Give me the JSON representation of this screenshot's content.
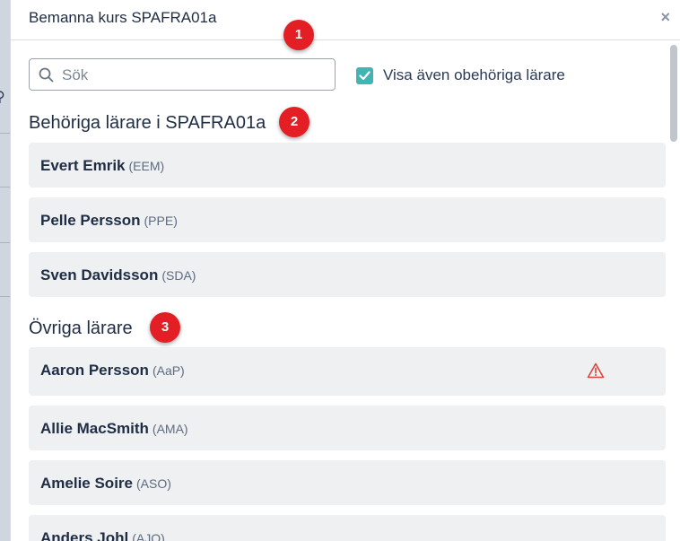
{
  "modal": {
    "title": "Bemanna kurs SPAFRA01a",
    "close_label": "×"
  },
  "search": {
    "placeholder": "Sök",
    "value": ""
  },
  "show_unqualified": {
    "label": "Visa även obehöriga lärare",
    "checked": true
  },
  "qualified_section": {
    "heading": "Behöriga lärare i SPAFRA01a",
    "teachers": [
      {
        "name": "Evert Emrik",
        "code": "(EEM)"
      },
      {
        "name": "Pelle Persson",
        "code": "(PPE)"
      },
      {
        "name": "Sven Davidsson",
        "code": "(SDA)"
      }
    ]
  },
  "other_section": {
    "heading": "Övriga lärare",
    "teachers": [
      {
        "name": "Aaron Persson",
        "code": "(AaP)",
        "icon": "warning-triangle-icon"
      },
      {
        "name": "Allie MacSmith",
        "code": "(AMA)"
      },
      {
        "name": "Amelie Soire",
        "code": "(ASO)"
      },
      {
        "name": "Anders Johl",
        "code": "(AJO)"
      }
    ]
  },
  "annotations": [
    "1",
    "2",
    "3"
  ],
  "colors": {
    "accent": "#3fb6b2",
    "badge": "#e31e24",
    "warning": "#e0473a",
    "row_bg": "#eef0f2"
  }
}
